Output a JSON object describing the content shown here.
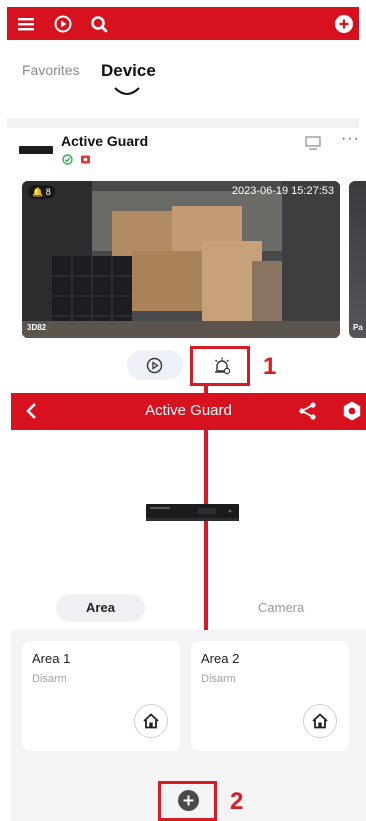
{
  "topbar": {
    "icons": [
      "menu-icon",
      "playback-icon",
      "search-icon",
      "add-icon"
    ],
    "color": "#d8111e"
  },
  "tabs": [
    {
      "label": "Favorites",
      "active": false
    },
    {
      "label": "Device",
      "active": true
    }
  ],
  "device": {
    "name": "Active Guard",
    "status_icons": [
      "online-check-icon",
      "recording-icon"
    ],
    "actions": [
      "screen-icon",
      "more-icon"
    ],
    "more_label": "···"
  },
  "camera": {
    "badge": "8",
    "timestamp": "2023-06-19 15:27:53",
    "label": "3D82",
    "next_label": "Pa"
  },
  "controls": {
    "buttons": [
      "playback-button",
      "alarm-button"
    ]
  },
  "callouts": {
    "first": "1",
    "second": "2"
  },
  "screen2": {
    "header": {
      "title": "Active Guard",
      "icons": [
        "back-icon",
        "share-icon",
        "settings-icon"
      ]
    },
    "segments": [
      {
        "label": "Area",
        "active": true
      },
      {
        "label": "Camera",
        "active": false
      }
    ],
    "areas": [
      {
        "name": "Area 1",
        "status": "Disarm"
      },
      {
        "name": "Area 2",
        "status": "Disarm"
      }
    ],
    "fab_icon": "add-icon"
  },
  "colors": {
    "brand_red": "#d8111e",
    "callout_red": "#d81b22"
  }
}
